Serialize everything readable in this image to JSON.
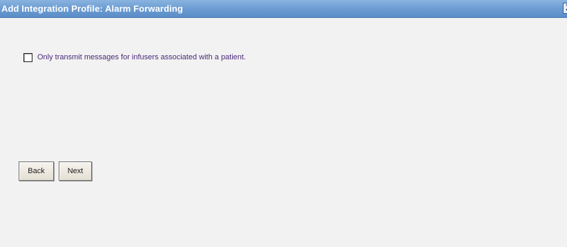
{
  "dialog": {
    "title": "Add Integration Profile: Alarm Forwarding",
    "close_icon": "close-icon",
    "close_glyph": "X"
  },
  "option": {
    "checked": false,
    "label": "Only transmit messages for infusers associated with a patient."
  },
  "buttons": {
    "back_label": "Back",
    "next_label": "Next"
  },
  "colors": {
    "titlebar": "#6f9fd4",
    "title_text": "#ffffff",
    "background": "#f2f2f2",
    "label_text": "#4a2a7a"
  }
}
